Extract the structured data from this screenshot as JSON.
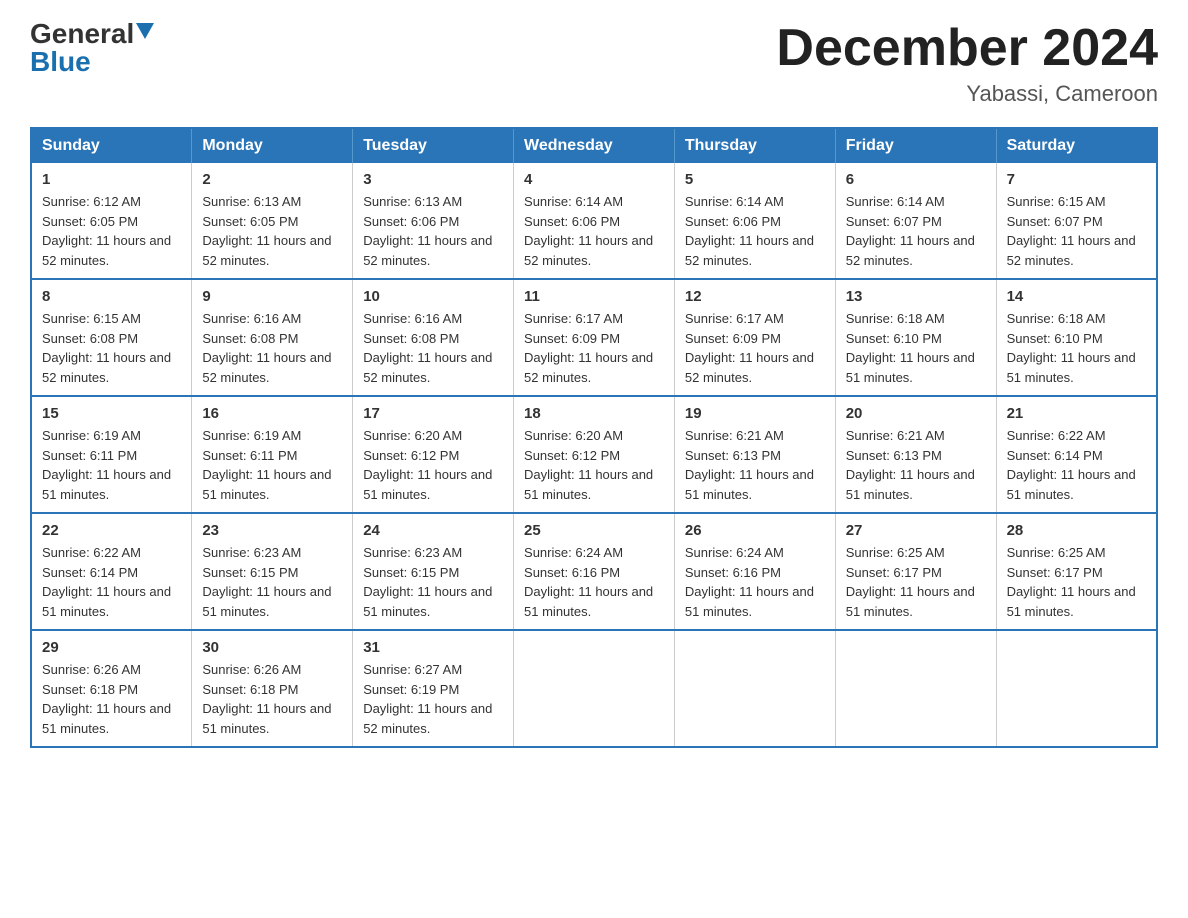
{
  "header": {
    "logo": {
      "general": "General",
      "blue": "Blue",
      "arrow": "▼"
    },
    "title": "December 2024",
    "location": "Yabassi, Cameroon"
  },
  "days_of_week": [
    "Sunday",
    "Monday",
    "Tuesday",
    "Wednesday",
    "Thursday",
    "Friday",
    "Saturday"
  ],
  "weeks": [
    [
      {
        "day": 1,
        "sunrise": "6:12 AM",
        "sunset": "6:05 PM",
        "daylight": "11 hours and 52 minutes."
      },
      {
        "day": 2,
        "sunrise": "6:13 AM",
        "sunset": "6:05 PM",
        "daylight": "11 hours and 52 minutes."
      },
      {
        "day": 3,
        "sunrise": "6:13 AM",
        "sunset": "6:06 PM",
        "daylight": "11 hours and 52 minutes."
      },
      {
        "day": 4,
        "sunrise": "6:14 AM",
        "sunset": "6:06 PM",
        "daylight": "11 hours and 52 minutes."
      },
      {
        "day": 5,
        "sunrise": "6:14 AM",
        "sunset": "6:06 PM",
        "daylight": "11 hours and 52 minutes."
      },
      {
        "day": 6,
        "sunrise": "6:14 AM",
        "sunset": "6:07 PM",
        "daylight": "11 hours and 52 minutes."
      },
      {
        "day": 7,
        "sunrise": "6:15 AM",
        "sunset": "6:07 PM",
        "daylight": "11 hours and 52 minutes."
      }
    ],
    [
      {
        "day": 8,
        "sunrise": "6:15 AM",
        "sunset": "6:08 PM",
        "daylight": "11 hours and 52 minutes."
      },
      {
        "day": 9,
        "sunrise": "6:16 AM",
        "sunset": "6:08 PM",
        "daylight": "11 hours and 52 minutes."
      },
      {
        "day": 10,
        "sunrise": "6:16 AM",
        "sunset": "6:08 PM",
        "daylight": "11 hours and 52 minutes."
      },
      {
        "day": 11,
        "sunrise": "6:17 AM",
        "sunset": "6:09 PM",
        "daylight": "11 hours and 52 minutes."
      },
      {
        "day": 12,
        "sunrise": "6:17 AM",
        "sunset": "6:09 PM",
        "daylight": "11 hours and 52 minutes."
      },
      {
        "day": 13,
        "sunrise": "6:18 AM",
        "sunset": "6:10 PM",
        "daylight": "11 hours and 51 minutes."
      },
      {
        "day": 14,
        "sunrise": "6:18 AM",
        "sunset": "6:10 PM",
        "daylight": "11 hours and 51 minutes."
      }
    ],
    [
      {
        "day": 15,
        "sunrise": "6:19 AM",
        "sunset": "6:11 PM",
        "daylight": "11 hours and 51 minutes."
      },
      {
        "day": 16,
        "sunrise": "6:19 AM",
        "sunset": "6:11 PM",
        "daylight": "11 hours and 51 minutes."
      },
      {
        "day": 17,
        "sunrise": "6:20 AM",
        "sunset": "6:12 PM",
        "daylight": "11 hours and 51 minutes."
      },
      {
        "day": 18,
        "sunrise": "6:20 AM",
        "sunset": "6:12 PM",
        "daylight": "11 hours and 51 minutes."
      },
      {
        "day": 19,
        "sunrise": "6:21 AM",
        "sunset": "6:13 PM",
        "daylight": "11 hours and 51 minutes."
      },
      {
        "day": 20,
        "sunrise": "6:21 AM",
        "sunset": "6:13 PM",
        "daylight": "11 hours and 51 minutes."
      },
      {
        "day": 21,
        "sunrise": "6:22 AM",
        "sunset": "6:14 PM",
        "daylight": "11 hours and 51 minutes."
      }
    ],
    [
      {
        "day": 22,
        "sunrise": "6:22 AM",
        "sunset": "6:14 PM",
        "daylight": "11 hours and 51 minutes."
      },
      {
        "day": 23,
        "sunrise": "6:23 AM",
        "sunset": "6:15 PM",
        "daylight": "11 hours and 51 minutes."
      },
      {
        "day": 24,
        "sunrise": "6:23 AM",
        "sunset": "6:15 PM",
        "daylight": "11 hours and 51 minutes."
      },
      {
        "day": 25,
        "sunrise": "6:24 AM",
        "sunset": "6:16 PM",
        "daylight": "11 hours and 51 minutes."
      },
      {
        "day": 26,
        "sunrise": "6:24 AM",
        "sunset": "6:16 PM",
        "daylight": "11 hours and 51 minutes."
      },
      {
        "day": 27,
        "sunrise": "6:25 AM",
        "sunset": "6:17 PM",
        "daylight": "11 hours and 51 minutes."
      },
      {
        "day": 28,
        "sunrise": "6:25 AM",
        "sunset": "6:17 PM",
        "daylight": "11 hours and 51 minutes."
      }
    ],
    [
      {
        "day": 29,
        "sunrise": "6:26 AM",
        "sunset": "6:18 PM",
        "daylight": "11 hours and 51 minutes."
      },
      {
        "day": 30,
        "sunrise": "6:26 AM",
        "sunset": "6:18 PM",
        "daylight": "11 hours and 51 minutes."
      },
      {
        "day": 31,
        "sunrise": "6:27 AM",
        "sunset": "6:19 PM",
        "daylight": "11 hours and 52 minutes."
      },
      null,
      null,
      null,
      null
    ]
  ]
}
